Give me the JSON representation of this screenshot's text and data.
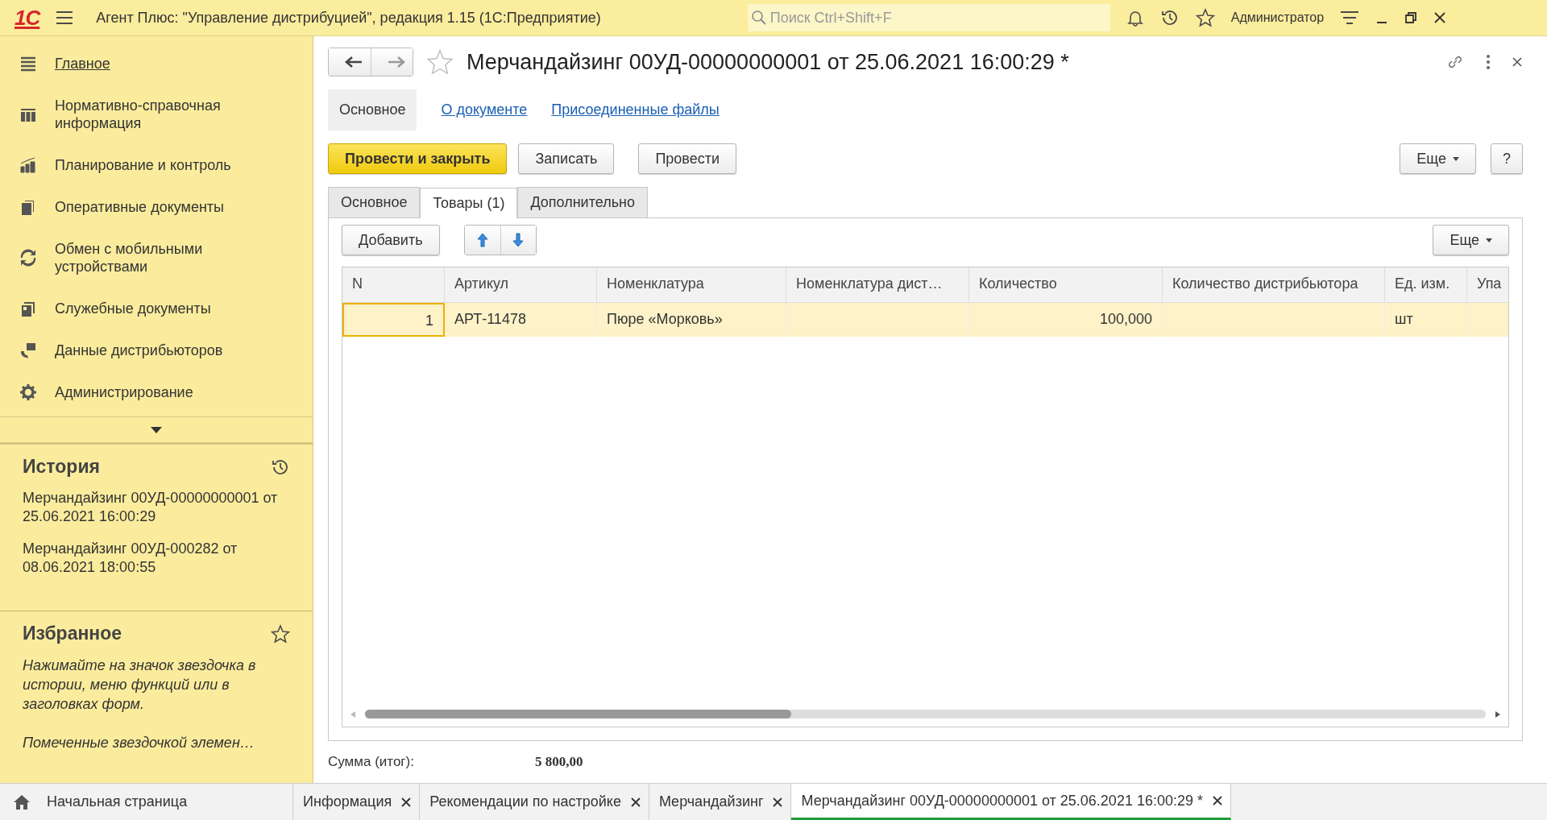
{
  "topbar": {
    "logo": "1С",
    "title": "Агент Плюс: \"Управление дистрибуцией\", редакция 1.15  (1С:Предприятие)",
    "search": {
      "placeholder": "Поиск Ctrl+Shift+F"
    },
    "user": "Администратор"
  },
  "sidebar": {
    "items": [
      {
        "label": "Главное",
        "selected": true
      },
      {
        "label": "Нормативно-справочная информация",
        "selected": false
      },
      {
        "label": "Планирование и контроль",
        "selected": false
      },
      {
        "label": "Оперативные документы",
        "selected": false
      },
      {
        "label": "Обмен с мобильными устройствами",
        "selected": false
      },
      {
        "label": "Служебные документы",
        "selected": false
      },
      {
        "label": "Данные дистрибьюторов",
        "selected": false
      },
      {
        "label": "Администрирование",
        "selected": false
      }
    ],
    "history": {
      "title": "История",
      "items": [
        "Мерчандайзинг 00УД-00000000001 от 25.06.2021 16:00:29",
        "Мерчандайзинг 00УД-000282 от 08.06.2021 18:00:55"
      ]
    },
    "favorites": {
      "title": "Избранное",
      "hints": [
        "Нажимайте на значок звездочка в истории, меню функций или в заголовках форм.",
        "Помеченные звездочкой элемен…"
      ]
    }
  },
  "form": {
    "title": "Мерчандайзинг 00УД-00000000001 от 25.06.2021 16:00:29 *",
    "nav": [
      {
        "label": "Основное",
        "selected": true
      },
      {
        "label": "О документе",
        "selected": false
      },
      {
        "label": "Присоединенные файлы",
        "selected": false
      }
    ],
    "buttons": [
      {
        "label": "Провести и закрыть",
        "kind": "primary"
      },
      {
        "label": "Записать",
        "kind": "normal"
      },
      {
        "label": "Провести",
        "kind": "normal"
      }
    ],
    "more_button": "Еще",
    "help_button": "?",
    "tabs": [
      {
        "label": "Основное",
        "selected": false
      },
      {
        "label": "Товары (1)",
        "selected": true
      },
      {
        "label": "Дополнительно",
        "selected": false
      }
    ],
    "table_toolbar": {
      "add_button": "Добавить",
      "more_button": "Еще"
    },
    "table": {
      "columns": [
        {
          "label": "N",
          "kind": "number"
        },
        {
          "label": "Артикул",
          "kind": "text"
        },
        {
          "label": "Номенклатура",
          "kind": "text"
        },
        {
          "label": "Номенклатура дист…",
          "kind": "text"
        },
        {
          "label": "Количество",
          "kind": "number"
        },
        {
          "label": "Количество дистрибьютора",
          "kind": "text"
        },
        {
          "label": "Ед. изм.",
          "kind": "text"
        },
        {
          "label": "Упа",
          "kind": "text"
        }
      ],
      "rows": [
        {
          "selected": true,
          "cells": [
            {
              "text": "1",
              "focused": true
            },
            {
              "text": "АРТ-11478",
              "focused": false
            },
            {
              "text": "Пюре «Морковь»",
              "focused": false
            },
            {
              "focused": false
            },
            {
              "text": "100,000",
              "focused": false
            },
            {
              "focused": false
            },
            {
              "text": "шт",
              "focused": false
            },
            {
              "focused": false
            }
          ]
        }
      ]
    },
    "total": {
      "label": "Сумма (итог):",
      "value": "5 800,00"
    }
  },
  "open_tabs": [
    {
      "label": "Начальная страница",
      "kind": "home",
      "selected": false
    },
    {
      "label": "Информация",
      "kind": "closable",
      "selected": false
    },
    {
      "label": "Рекомендации по настройке",
      "kind": "closable",
      "selected": false
    },
    {
      "label": "Мерчандайзинг",
      "kind": "closable",
      "selected": false
    },
    {
      "label": "Мерчандайзинг 00УД-00000000001 от 25.06.2021 16:00:29 *",
      "kind": "closable",
      "selected": true
    }
  ]
}
